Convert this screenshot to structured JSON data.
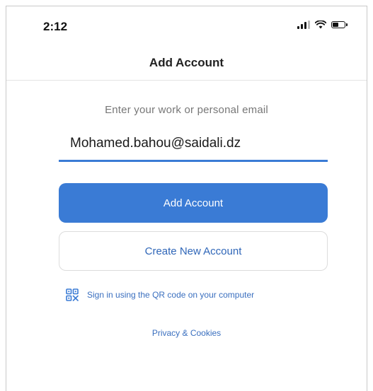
{
  "status_bar": {
    "time": "2:12",
    "icons": [
      "signal-icon",
      "wifi-icon",
      "battery-icon"
    ],
    "battery_level": 0.55
  },
  "nav": {
    "title": "Add Account"
  },
  "form": {
    "prompt": "Enter your work or personal email",
    "email_value": "Mohamed.bahou@saidali.dz",
    "add_account_label": "Add Account",
    "create_account_label": "Create New Account"
  },
  "qr": {
    "icon": "qr-code-icon",
    "label": "Sign in using the QR code on your computer"
  },
  "footer": {
    "privacy_label": "Privacy & Cookies"
  },
  "colors": {
    "accent": "#3a7bd5",
    "link": "#3a6fbf",
    "prompt_text": "#777777"
  }
}
